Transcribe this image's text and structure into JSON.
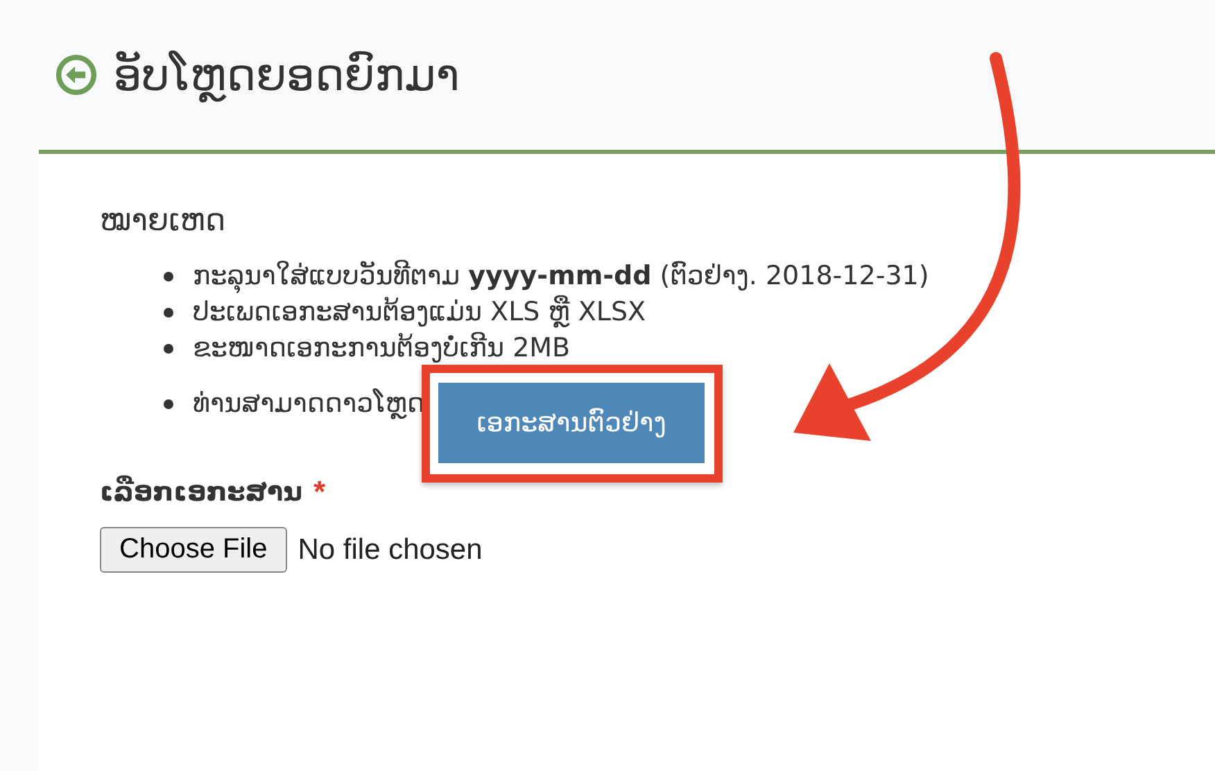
{
  "header": {
    "title": "ອັບໂຫຼດຍອດຍົກມາ"
  },
  "notes": {
    "heading": "ໝາຍເຫດ",
    "items": [
      {
        "kind": "text",
        "text": "ກະລຸນາໃສ່ແບບວັນທີຕາມ **yyyy-mm-dd** (ຕົວຢ່າງ. 2018-12-31)"
      },
      {
        "kind": "text",
        "text": "ປະເພດເອກະສານຕ້ອງແມ່ນ XLS ຫຼື XLSX"
      },
      {
        "kind": "text",
        "text": "ຂະໜາດເອກະການຕ້ອງບໍ່ເກີນ 2MB"
      },
      {
        "kind": "download",
        "text": "ທ່ານສາມາດດາວໂຫຼດ",
        "button": "ເອກະສານຕົວຢ່າງ"
      }
    ]
  },
  "file_field": {
    "label": "ເລືອກເອກະສານ",
    "required_mark": "*",
    "button": "Choose File",
    "status": "No file chosen"
  }
}
